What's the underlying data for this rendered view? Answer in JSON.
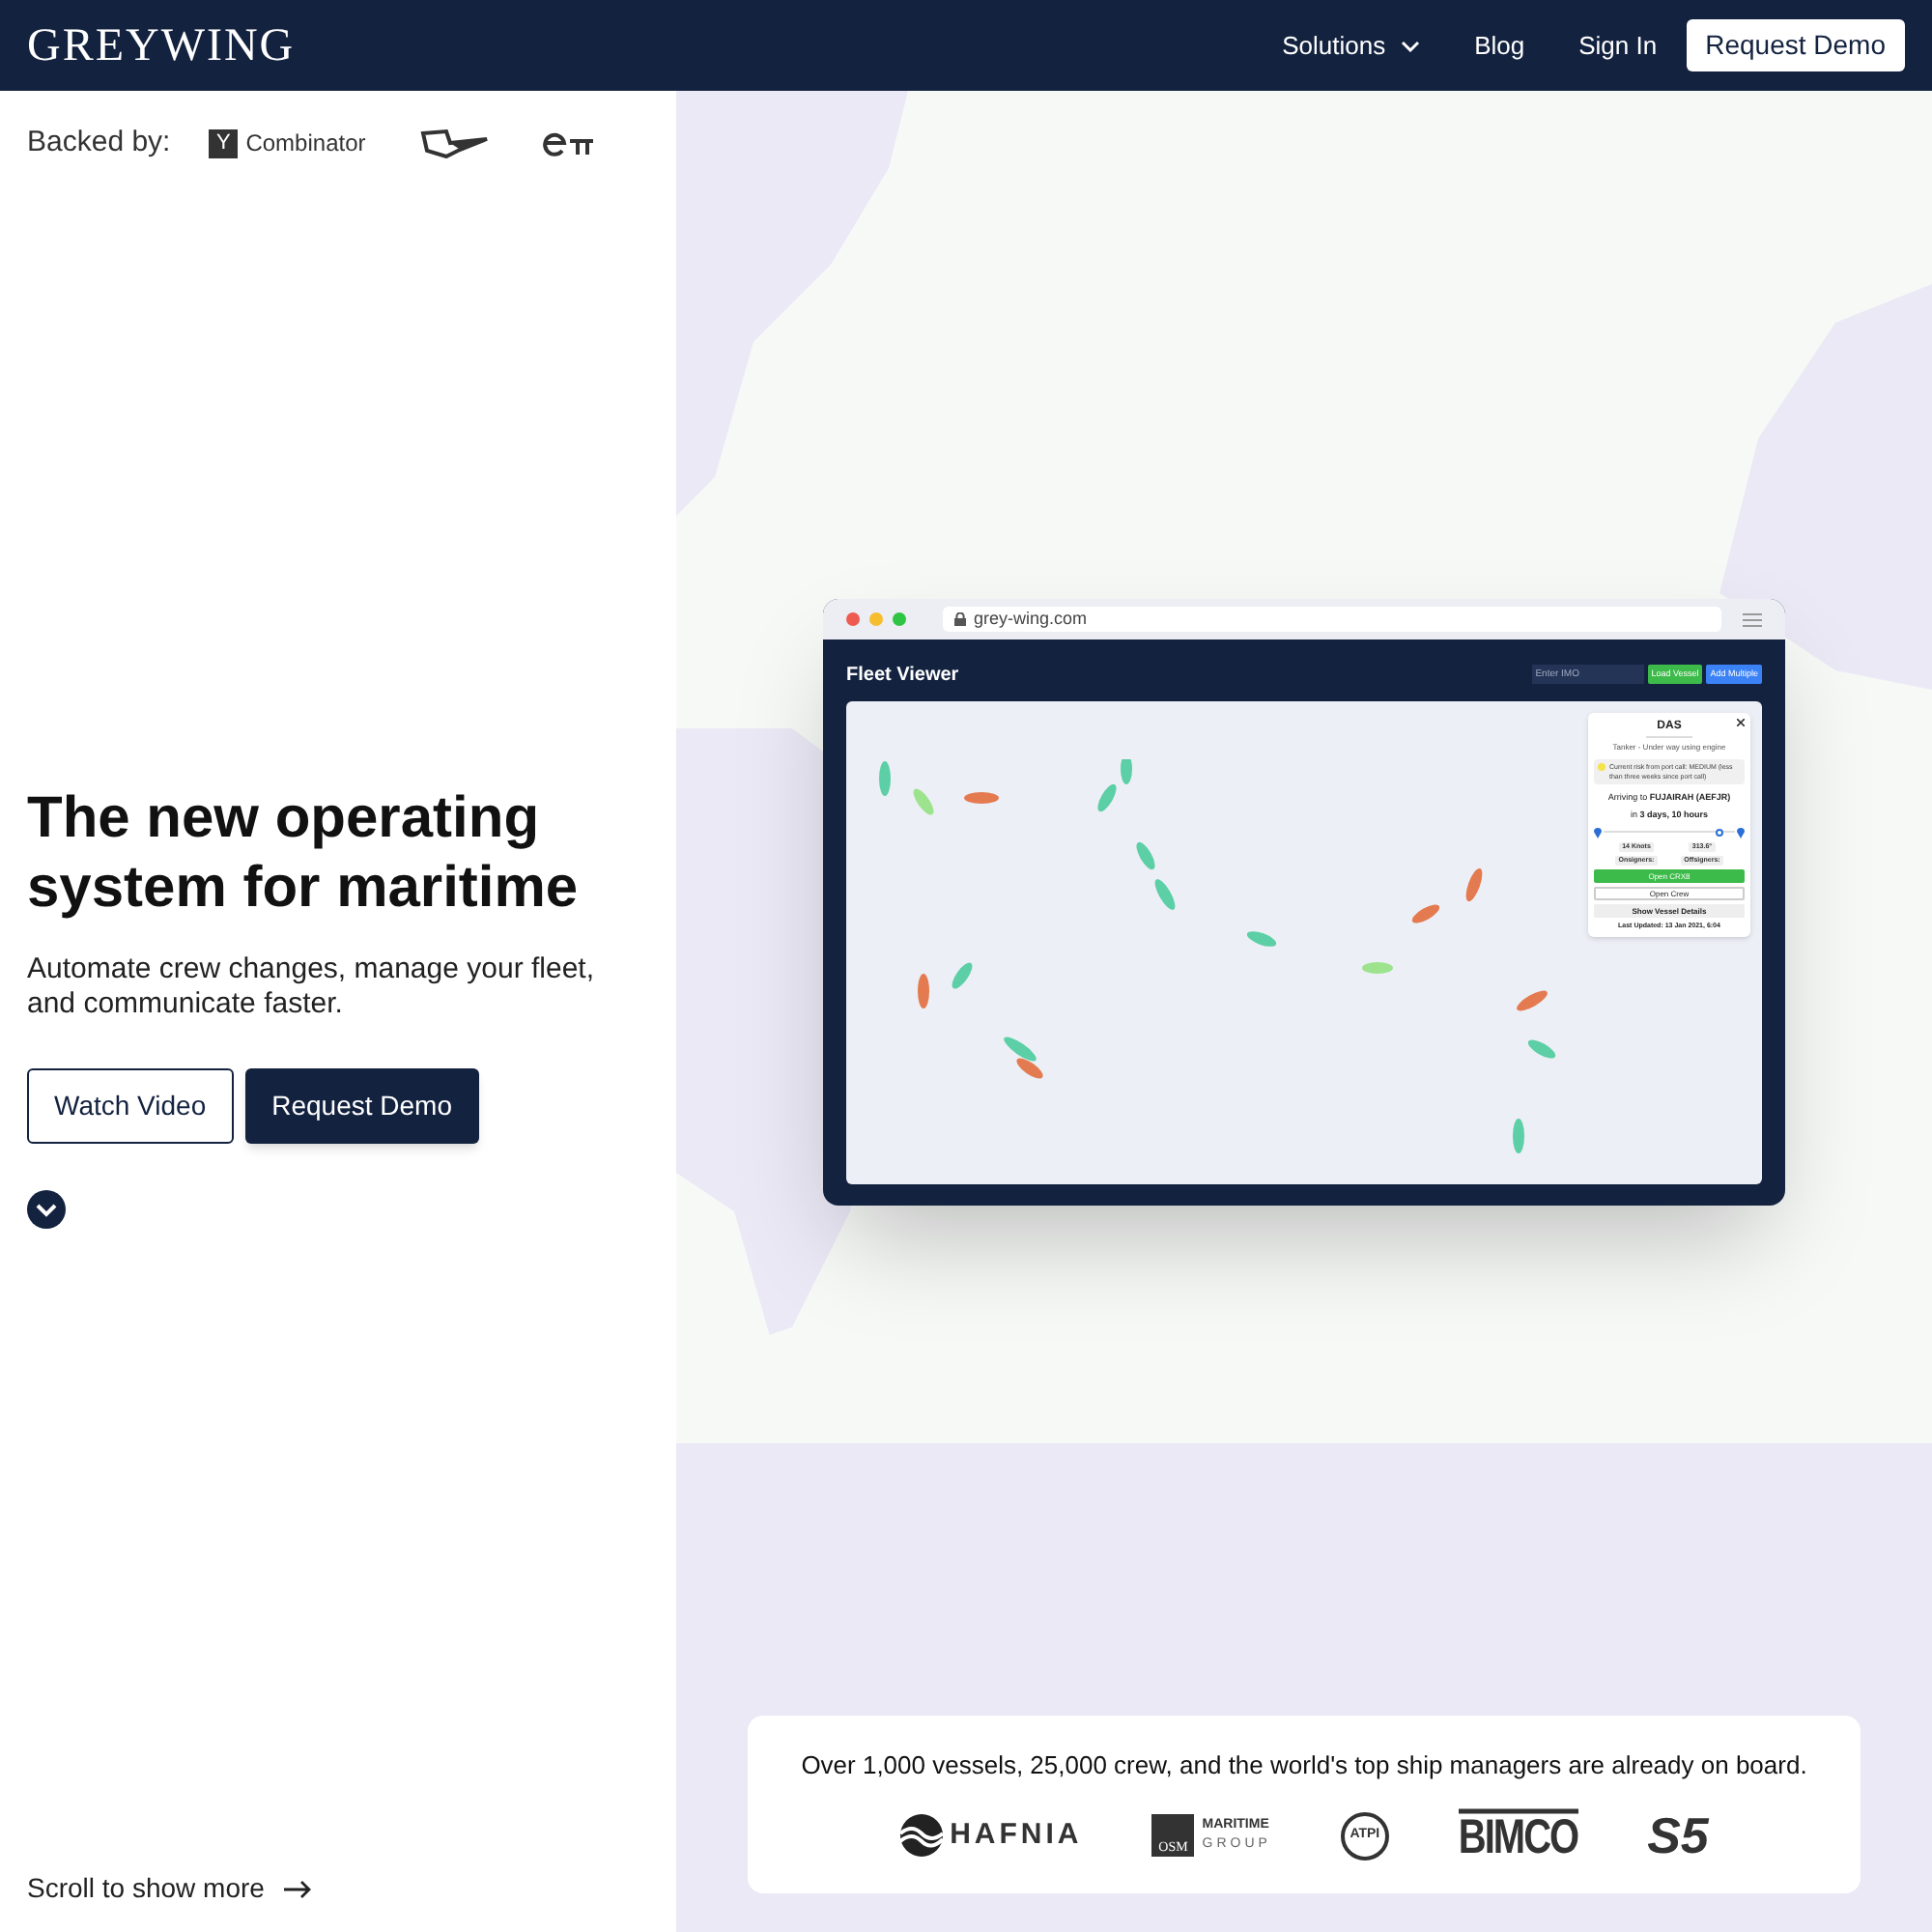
{
  "nav": {
    "logo": "GREYWING",
    "links": [
      {
        "label": "Solutions",
        "dropdown": true
      },
      {
        "label": "Blog",
        "dropdown": false
      },
      {
        "label": "Sign In",
        "dropdown": false
      }
    ],
    "cta": "Request Demo"
  },
  "backed_by": {
    "label": "Backed by:",
    "yc_mark": "Y",
    "yc_name": "Combinator"
  },
  "hero": {
    "title": "The new operating system for maritime",
    "subtitle": "Automate crew changes, manage your fleet, and communicate faster.",
    "buttons": [
      {
        "label": "Watch Video",
        "kind": "outline"
      },
      {
        "label": "Request Demo",
        "kind": "solid"
      }
    ]
  },
  "scroll_hint": "Scroll to show more",
  "mockup": {
    "url": "grey-wing.com",
    "title": "Fleet Viewer",
    "imo_placeholder": "Enter IMO",
    "buttons": [
      {
        "label": "Load Vessel",
        "color": "#3dbb4a"
      },
      {
        "label": "Add Multiple",
        "color": "#3b82f6"
      }
    ],
    "popup": {
      "title": "DAS",
      "subtitle": "Tanker - Under way using engine",
      "risk": "Current risk from port call: MEDIUM (less than three weeks since port call)",
      "arrival": "Arriving to **FUJAIRAH (AEFJR)**",
      "eta": "in **3 days, 10 hours**",
      "level": 0.88,
      "chips": [
        "14 Knots",
        "313.6°",
        "Onsigners:",
        "Offsigners:"
      ],
      "actions": [
        {
          "label": "Open CRX8",
          "kind": "primary"
        },
        {
          "label": "Open Crew",
          "kind": "outline"
        },
        {
          "label": "Show Vessel Details",
          "kind": "toggle"
        }
      ],
      "updated": "Last Updated: 13 Jan 2021, 6:04"
    }
  },
  "partners": {
    "text": "Over 1,000 vessels, 25,000 crew, and the world's top ship managers are already on board.",
    "logos": [
      {
        "kind": "hafnia",
        "name": "HAFNIA"
      },
      {
        "kind": "osm",
        "mark": "OSM",
        "name": "MARITIME",
        "sub": "GROUP"
      },
      {
        "kind": "atpi",
        "name": "ATPI"
      },
      {
        "kind": "bimco",
        "name": "BIMCO"
      },
      {
        "kind": "s5",
        "name": "S5"
      }
    ]
  }
}
